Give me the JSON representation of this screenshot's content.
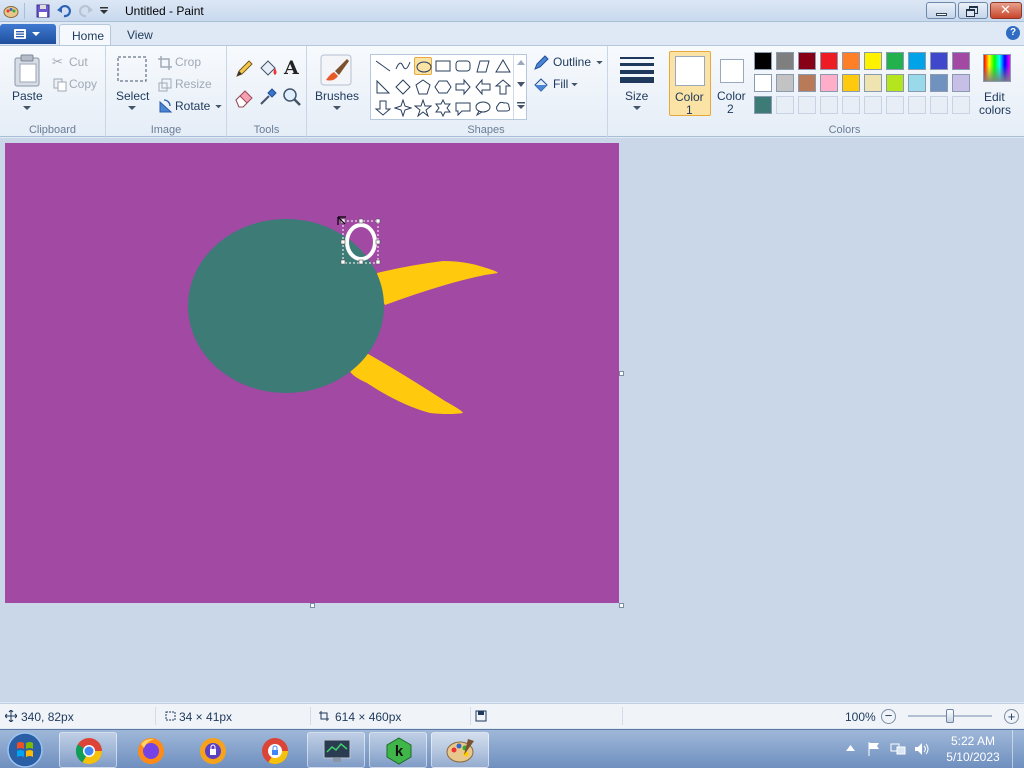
{
  "window": {
    "title": "Untitled - Paint"
  },
  "tabs": [
    {
      "label": "Home",
      "active": true
    },
    {
      "label": "View",
      "active": false
    }
  ],
  "ribbon": {
    "clipboard": {
      "group_label": "Clipboard",
      "paste": "Paste",
      "cut": "Cut",
      "copy": "Copy"
    },
    "image": {
      "group_label": "Image",
      "select": "Select",
      "crop": "Crop",
      "resize": "Resize",
      "rotate": "Rotate"
    },
    "tools": {
      "group_label": "Tools"
    },
    "brushes": {
      "label": "Brushes"
    },
    "shapes": {
      "group_label": "Shapes",
      "outline": "Outline",
      "fill": "Fill",
      "selected_shape": "oval"
    },
    "size": {
      "label": "Size"
    },
    "colors": {
      "group_label": "Colors",
      "color1_label_a": "Color",
      "color1_label_b": "1",
      "color2_label_a": "Color",
      "color2_label_b": "2",
      "color1_value": "#ffffff",
      "color2_value": "#ffffff",
      "edit_label_a": "Edit",
      "edit_label_b": "colors",
      "palette_row1": [
        "#000000",
        "#7f7f7f",
        "#880015",
        "#ed1c24",
        "#ff7f27",
        "#fff200",
        "#22b14c",
        "#00a2e8",
        "#3f48cc",
        "#a349a4"
      ],
      "palette_row2": [
        "#ffffff",
        "#c3c3c3",
        "#b97a57",
        "#ffaec9",
        "#ffc90e",
        "#efe4b0",
        "#b5e61d",
        "#99d9ea",
        "#7092be",
        "#c8bfe7"
      ],
      "palette_row3": [
        "#3d7b77",
        "",
        "",
        "",
        "",
        "",
        "",
        "",
        "",
        ""
      ]
    }
  },
  "canvas": {
    "background": "#a149a3",
    "body_color": "#3d7b77",
    "fin_color": "#ffc90e"
  },
  "status": {
    "cursor_pos": "340, 82px",
    "selection_size": "34 × 41px",
    "image_size": "614 × 460px",
    "zoom": "100%"
  },
  "taskbar": {
    "time": "5:22 AM",
    "date": "5/10/2023"
  }
}
